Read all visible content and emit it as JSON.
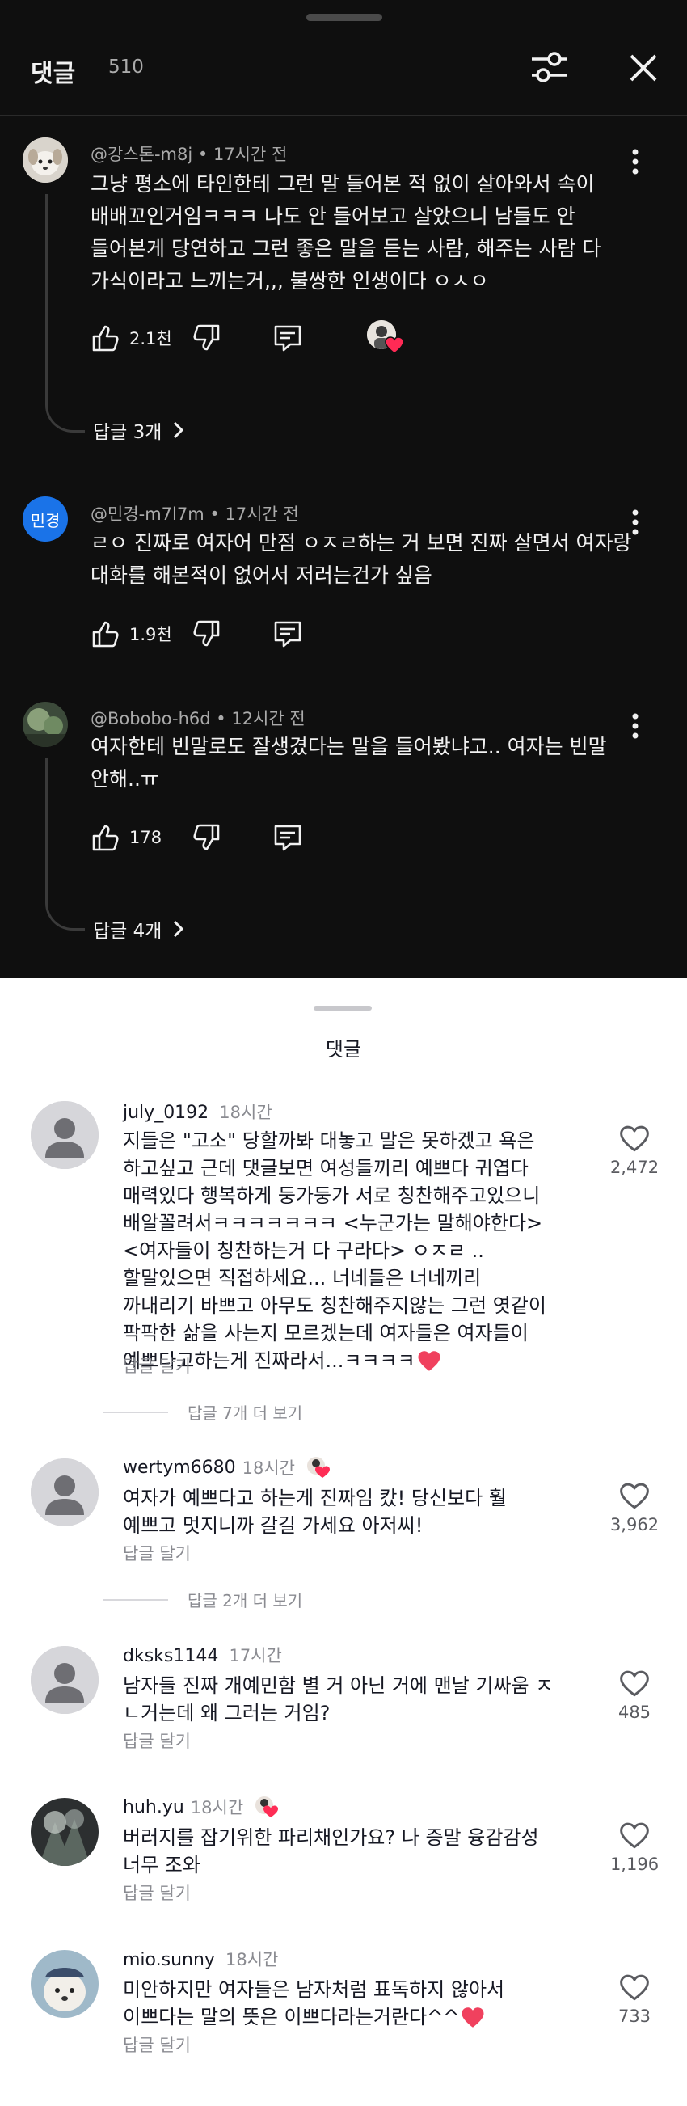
{
  "header": {
    "title": "댓글",
    "count": "510"
  },
  "dark_comments": [
    {
      "author": "@강스톤-m8j",
      "time": "17시간 전",
      "lines": [
        "그냥 평소에 타인한테 그런 말 들어본 적 없이 살아와서 속이",
        "배배꼬인거임ㅋㅋㅋ 나도 안 들어보고 살았으니 남들도 안",
        "들어본게 당연하고 그런 좋은 말을 듣는 사람, 해주는 사람 다",
        "가식이라고 느끼는거,,, 불쌍한 인생이다 ㅇㅅㅇ"
      ],
      "likes": "2.1천",
      "replies": "답글 3개"
    },
    {
      "author": "@민경-m7l7m",
      "avatar_text": "민경",
      "time": "17시간 전",
      "lines": [
        "ㄹㅇ 진짜로 여자어 만점 ㅇㅈㄹ하는 거 보면 진짜 살면서 여자랑",
        "대화를 해본적이 없어서  저러는건가 싶음"
      ],
      "likes": "1.9천"
    },
    {
      "author": "@Bobobo-h6d",
      "time": "12시간 전",
      "lines": [
        "여자한테 빈말로도 잘생겼다는 말을 들어봤냐고.. 여자는 빈말",
        "안해..ㅠ"
      ],
      "likes": "178",
      "replies": "답글 4개"
    }
  ],
  "sheet": {
    "title": "댓글"
  },
  "light_comments": [
    {
      "user": "july_0192",
      "time": "18시간",
      "lines": [
        "지들은 \"고소\" 당할까봐 대놓고 말은 못하겠고 욕은",
        "하고싶고 근데 댓글보면 여성들끼리 예쁘다 귀엽다",
        "매력있다 행복하게 둥가둥가 서로 칭찬해주고있으니",
        "배알꼴려서ㅋㅋㅋㅋㅋㅋㅋ <누군가는 말해야한다>",
        "<여자들이 칭찬하는거 다 구라다> ㅇㅈㄹ ..",
        "할말있으면 직접하세요... 너네들은 너네끼리",
        "까내리기 바쁘고 아무도 칭찬해주지않는 그런 엿같이",
        "팍팍한 삶을 사는지 모르겠는데 여자들은 여자들이",
        "예쁘다고하는게 진짜라서...ㅋㅋㅋㅋ"
      ],
      "reply_label": "답글 달기",
      "likes": "2,472",
      "more_replies": "답글 7개 더 보기"
    },
    {
      "user": "wertym6680",
      "time": "18시간",
      "lines": [
        "여자가 예쁘다고 하는게 진짜임 캈! 당신보다 훨",
        "예쁘고 멋지니까 갈길 가세요 아저씨!"
      ],
      "reply_label": "답글 달기",
      "likes": "3,962",
      "more_replies": "답글 2개 더 보기"
    },
    {
      "user": "dksks1144",
      "time": "17시간",
      "lines": [
        "남자들 진짜 개예민함 별 거 아닌 거에 맨날 기싸움 ㅈ",
        "ㄴ거는데 왜 그러는 거임?"
      ],
      "reply_label": "답글 달기",
      "likes": "485"
    },
    {
      "user": "huh.yu",
      "time": "18시간",
      "lines": [
        "버러지를 잡기위한 파리채인가요? 나 증말 융감감성",
        "너무 조와"
      ],
      "reply_label": "답글 달기",
      "likes": "1,196"
    },
    {
      "user": "mio.sunny",
      "time": "18시간",
      "lines": [
        "미안하지만 여자들은 남자처럼 표독하지 않아서",
        "이쁘다는 말의 뜻은 이쁘다라는거란다^^"
      ],
      "reply_label": "답글 달기",
      "likes": "733"
    }
  ],
  "colors": {
    "dark_bg": "#0f0f0f",
    "brand_blue": "#1a73e8",
    "heart_red": "#fe2c55"
  }
}
